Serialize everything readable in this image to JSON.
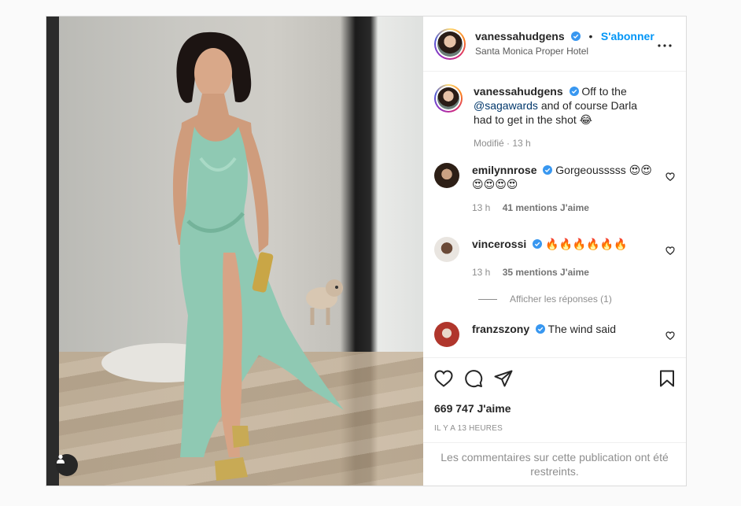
{
  "post": {
    "author": "vanessahudgens",
    "follow_label": "S'abonner",
    "dot": "•",
    "location": "Santa Monica Proper Hotel"
  },
  "caption": {
    "author": "vanessahudgens",
    "text_before": "Off to the",
    "mention": "@sagawards",
    "text_after": "and of course Darla had to get in the shot 😂",
    "meta": "Modifié · 13 h"
  },
  "comments": [
    {
      "author": "emilynnrose",
      "text": "Gorgeousssss 😍😍😍😍😍😍",
      "time": "13 h",
      "likes": "41 mentions J'aime"
    },
    {
      "author": "vincerossi",
      "text": "🔥🔥🔥🔥🔥🔥",
      "time": "13 h",
      "likes": "35 mentions J'aime"
    },
    {
      "author": "franzszony",
      "text": "The wind said"
    }
  ],
  "replies_label": "Afficher les réponses (1)",
  "likes_count": "669 747 J'aime",
  "timestamp": "IL Y A 13 HEURES",
  "restricted_notice": "Les commentaires sur cette publication ont été restreints.",
  "colors": {
    "accent": "#0095f6",
    "verified": "#3897f0",
    "dress": "#8fc9b3"
  }
}
